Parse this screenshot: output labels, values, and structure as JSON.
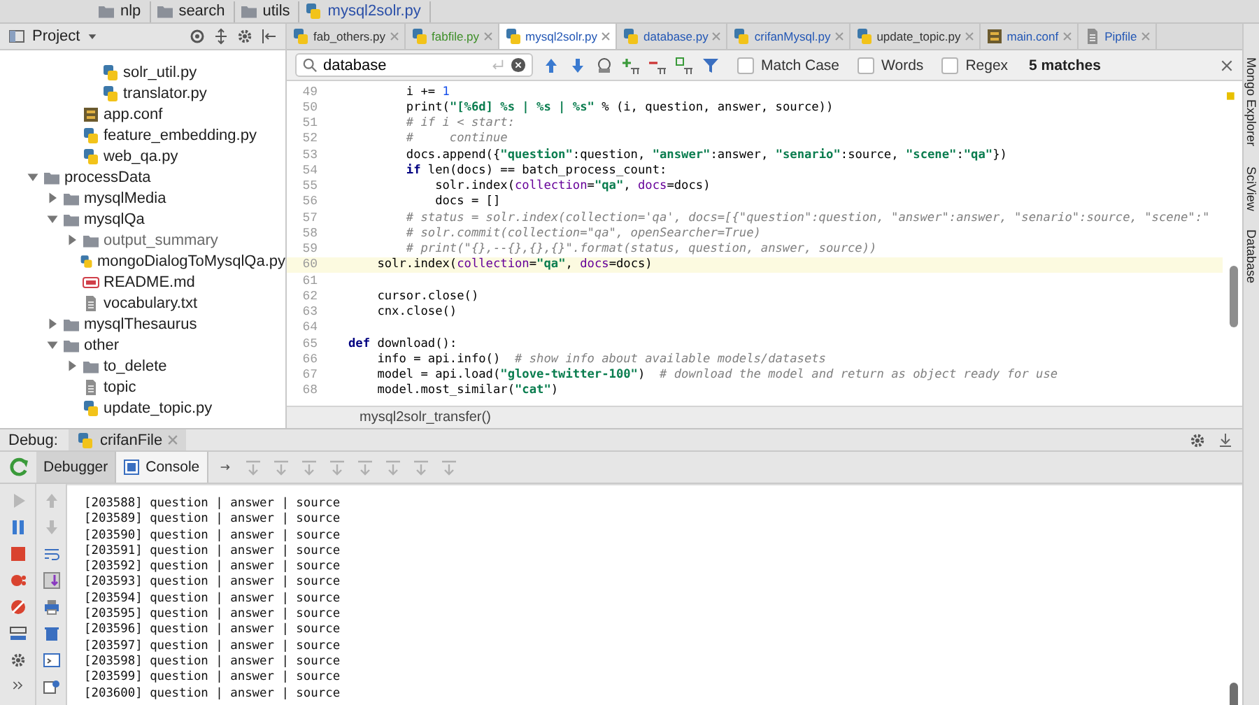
{
  "breadcrumbs": [
    {
      "label": "nlp",
      "kind": "folder"
    },
    {
      "label": "search",
      "kind": "folder"
    },
    {
      "label": "utils",
      "kind": "folder"
    },
    {
      "label": "mysql2solr.py",
      "kind": "py"
    }
  ],
  "project_panel": {
    "title": "Project",
    "tree": [
      {
        "children": [
          {
            "children": [
              {
                "children": [
                  {
                    "label": "solr_util.py",
                    "kind": "py"
                  },
                  {
                    "label": "translator.py",
                    "kind": "py"
                  }
                ]
              },
              {
                "label": "app.conf",
                "kind": "conf"
              },
              {
                "label": "feature_embedding.py",
                "kind": "py"
              },
              {
                "label": "web_qa.py",
                "kind": "py"
              }
            ]
          }
        ]
      },
      {
        "label": "processData",
        "kind": "folder",
        "expanded": true,
        "children": [
          {
            "label": "mysqlMedia",
            "kind": "folder",
            "expanded": false
          },
          {
            "label": "mysqlQa",
            "kind": "folder",
            "expanded": true,
            "children": [
              {
                "label": "output_summary",
                "kind": "folder",
                "expanded": false,
                "muted": true
              },
              {
                "label": "mongoDialogToMysqlQa.py",
                "kind": "py"
              },
              {
                "label": "README.md",
                "kind": "md"
              },
              {
                "label": "vocabulary.txt",
                "kind": "txt"
              }
            ]
          },
          {
            "label": "mysqlThesaurus",
            "kind": "folder",
            "expanded": false
          },
          {
            "label": "other",
            "kind": "folder",
            "expanded": true,
            "children": [
              {
                "label": "to_delete",
                "kind": "folder",
                "expanded": false
              },
              {
                "label": "topic",
                "kind": "txt"
              },
              {
                "label": "update_topic.py",
                "kind": "py"
              }
            ]
          }
        ]
      }
    ]
  },
  "editor_tabs": [
    {
      "label": "fab_others.py",
      "color": "#333333",
      "selected": false
    },
    {
      "label": "fabfile.py",
      "color": "#3f8f2a",
      "selected": false
    },
    {
      "label": "mysql2solr.py",
      "color": "#2357b5",
      "selected": true
    },
    {
      "label": "database.py",
      "color": "#2357b5",
      "selected": false
    },
    {
      "label": "crifanMysql.py",
      "color": "#2357b5",
      "selected": false
    },
    {
      "label": "update_topic.py",
      "color": "#333333",
      "selected": false
    },
    {
      "label": "main.conf",
      "color": "#2357b5",
      "selected": false,
      "kind": "conf"
    },
    {
      "label": "Pipfile",
      "color": "#2357b5",
      "selected": false,
      "kind": "txt"
    }
  ],
  "search_bar": {
    "value": "database",
    "options": [
      {
        "label": "Match Case",
        "checked": false
      },
      {
        "label": "Words",
        "checked": false
      },
      {
        "label": "Regex",
        "checked": false
      }
    ],
    "match_count": "5 matches"
  },
  "code_lines": [
    {
      "number": "49",
      "current": false,
      "parts": [
        {
          "kind": "plain",
          "text": "        i += "
        },
        {
          "kind": "num",
          "text": "1"
        }
      ]
    },
    {
      "number": "50",
      "current": false,
      "parts": [
        {
          "kind": "plain",
          "text": "        print("
        },
        {
          "kind": "str",
          "text": "\"[%6d] %s | %s | %s\""
        },
        {
          "kind": "plain",
          "text": " % (i, question, answer, source))"
        }
      ]
    },
    {
      "number": "51",
      "current": false,
      "parts": [
        {
          "kind": "com",
          "text": "        # if i < start:"
        }
      ]
    },
    {
      "number": "52",
      "current": false,
      "parts": [
        {
          "kind": "com",
          "text": "        #     continue"
        }
      ]
    },
    {
      "number": "53",
      "current": false,
      "parts": [
        {
          "kind": "plain",
          "text": "        docs.append({"
        },
        {
          "kind": "str",
          "text": "\"question\""
        },
        {
          "kind": "plain",
          "text": ":question, "
        },
        {
          "kind": "str",
          "text": "\"answer\""
        },
        {
          "kind": "plain",
          "text": ":answer, "
        },
        {
          "kind": "str",
          "text": "\"senario\""
        },
        {
          "kind": "plain",
          "text": ":source, "
        },
        {
          "kind": "str",
          "text": "\"scene\""
        },
        {
          "kind": "plain",
          "text": ":"
        },
        {
          "kind": "str",
          "text": "\"qa\""
        },
        {
          "kind": "plain",
          "text": "})"
        }
      ]
    },
    {
      "number": "54",
      "current": false,
      "parts": [
        {
          "kind": "kw",
          "text": "        if"
        },
        {
          "kind": "plain",
          "text": " len(docs) == batch_process_count:"
        }
      ]
    },
    {
      "number": "55",
      "current": false,
      "parts": [
        {
          "kind": "plain",
          "text": "            solr.index("
        },
        {
          "kind": "param",
          "text": "collection"
        },
        {
          "kind": "plain",
          "text": "="
        },
        {
          "kind": "str",
          "text": "\"qa\""
        },
        {
          "kind": "plain",
          "text": ", "
        },
        {
          "kind": "param",
          "text": "docs"
        },
        {
          "kind": "plain",
          "text": "=docs)"
        }
      ]
    },
    {
      "number": "56",
      "current": false,
      "parts": [
        {
          "kind": "plain",
          "text": "            docs = []"
        }
      ]
    },
    {
      "number": "57",
      "current": false,
      "parts": [
        {
          "kind": "com",
          "text": "        # status = solr.index(collection='qa', docs=[{\"question\":question, \"answer\":answer, \"senario\":source, \"scene\":\""
        }
      ]
    },
    {
      "number": "58",
      "current": false,
      "parts": [
        {
          "kind": "com",
          "text": "        # solr.commit(collection=\"qa\", openSearcher=True)"
        }
      ]
    },
    {
      "number": "59",
      "current": false,
      "parts": [
        {
          "kind": "com",
          "text": "        # print(\"{},--{},{},{}\".format(status, question, answer, source))"
        }
      ]
    },
    {
      "number": "60",
      "current": true,
      "parts": [
        {
          "kind": "plain",
          "text": "    solr.index("
        },
        {
          "kind": "param",
          "text": "collection"
        },
        {
          "kind": "plain",
          "text": "="
        },
        {
          "kind": "str",
          "text": "\"qa\""
        },
        {
          "kind": "plain",
          "text": ", "
        },
        {
          "kind": "param",
          "text": "docs"
        },
        {
          "kind": "plain",
          "text": "=docs)"
        }
      ]
    },
    {
      "number": "61",
      "current": false
    },
    {
      "number": "62",
      "current": false,
      "parts": [
        {
          "kind": "plain",
          "text": "    cursor.close()"
        }
      ]
    },
    {
      "number": "63",
      "current": false,
      "parts": [
        {
          "kind": "plain",
          "text": "    cnx.close()"
        }
      ]
    },
    {
      "number": "64",
      "current": false
    },
    {
      "number": "65",
      "current": false,
      "parts": [
        {
          "kind": "kw",
          "text": "def"
        },
        {
          "kind": "plain",
          "text": " download():"
        }
      ]
    },
    {
      "number": "66",
      "current": false,
      "parts": [
        {
          "kind": "plain",
          "text": "    info = api.info()  "
        },
        {
          "kind": "com",
          "text": "# show info about available models/datasets"
        }
      ]
    },
    {
      "number": "67",
      "current": false,
      "parts": [
        {
          "kind": "plain",
          "text": "    model = api.load("
        },
        {
          "kind": "str",
          "text": "\"glove-twitter-100\""
        },
        {
          "kind": "plain",
          "text": ")  "
        },
        {
          "kind": "com",
          "text": "# download the model and return as object ready for use"
        }
      ]
    },
    {
      "number": "68",
      "current": false,
      "parts": [
        {
          "kind": "plain",
          "text": "    model.most_similar("
        },
        {
          "kind": "str",
          "text": "\"cat\""
        },
        {
          "kind": "plain",
          "text": ")"
        }
      ]
    }
  ],
  "editor_breadcrumb": "mysql2solr_transfer()",
  "tool_windows": [
    "Mongo Explorer",
    "SciView",
    "Database"
  ],
  "debug": {
    "label": "Debug:",
    "session_tab": "crifanFile",
    "tabs": [
      {
        "label": "Debugger",
        "selected": false
      },
      {
        "label": "Console",
        "selected": true
      }
    ],
    "console_lines": [
      "[203588] question | answer | source",
      "[203589] question | answer | source",
      "[203590] question | answer | source",
      "[203591] question | answer | source",
      "[203592] question | answer | source",
      "[203593] question | answer | source",
      "[203594] question | answer | source",
      "[203595] question | answer | source",
      "[203596] question | answer | source",
      "[203597] question | answer | source",
      "[203598] question | answer | source",
      "[203599] question | answer | source",
      "[203600] question | answer | source"
    ]
  }
}
